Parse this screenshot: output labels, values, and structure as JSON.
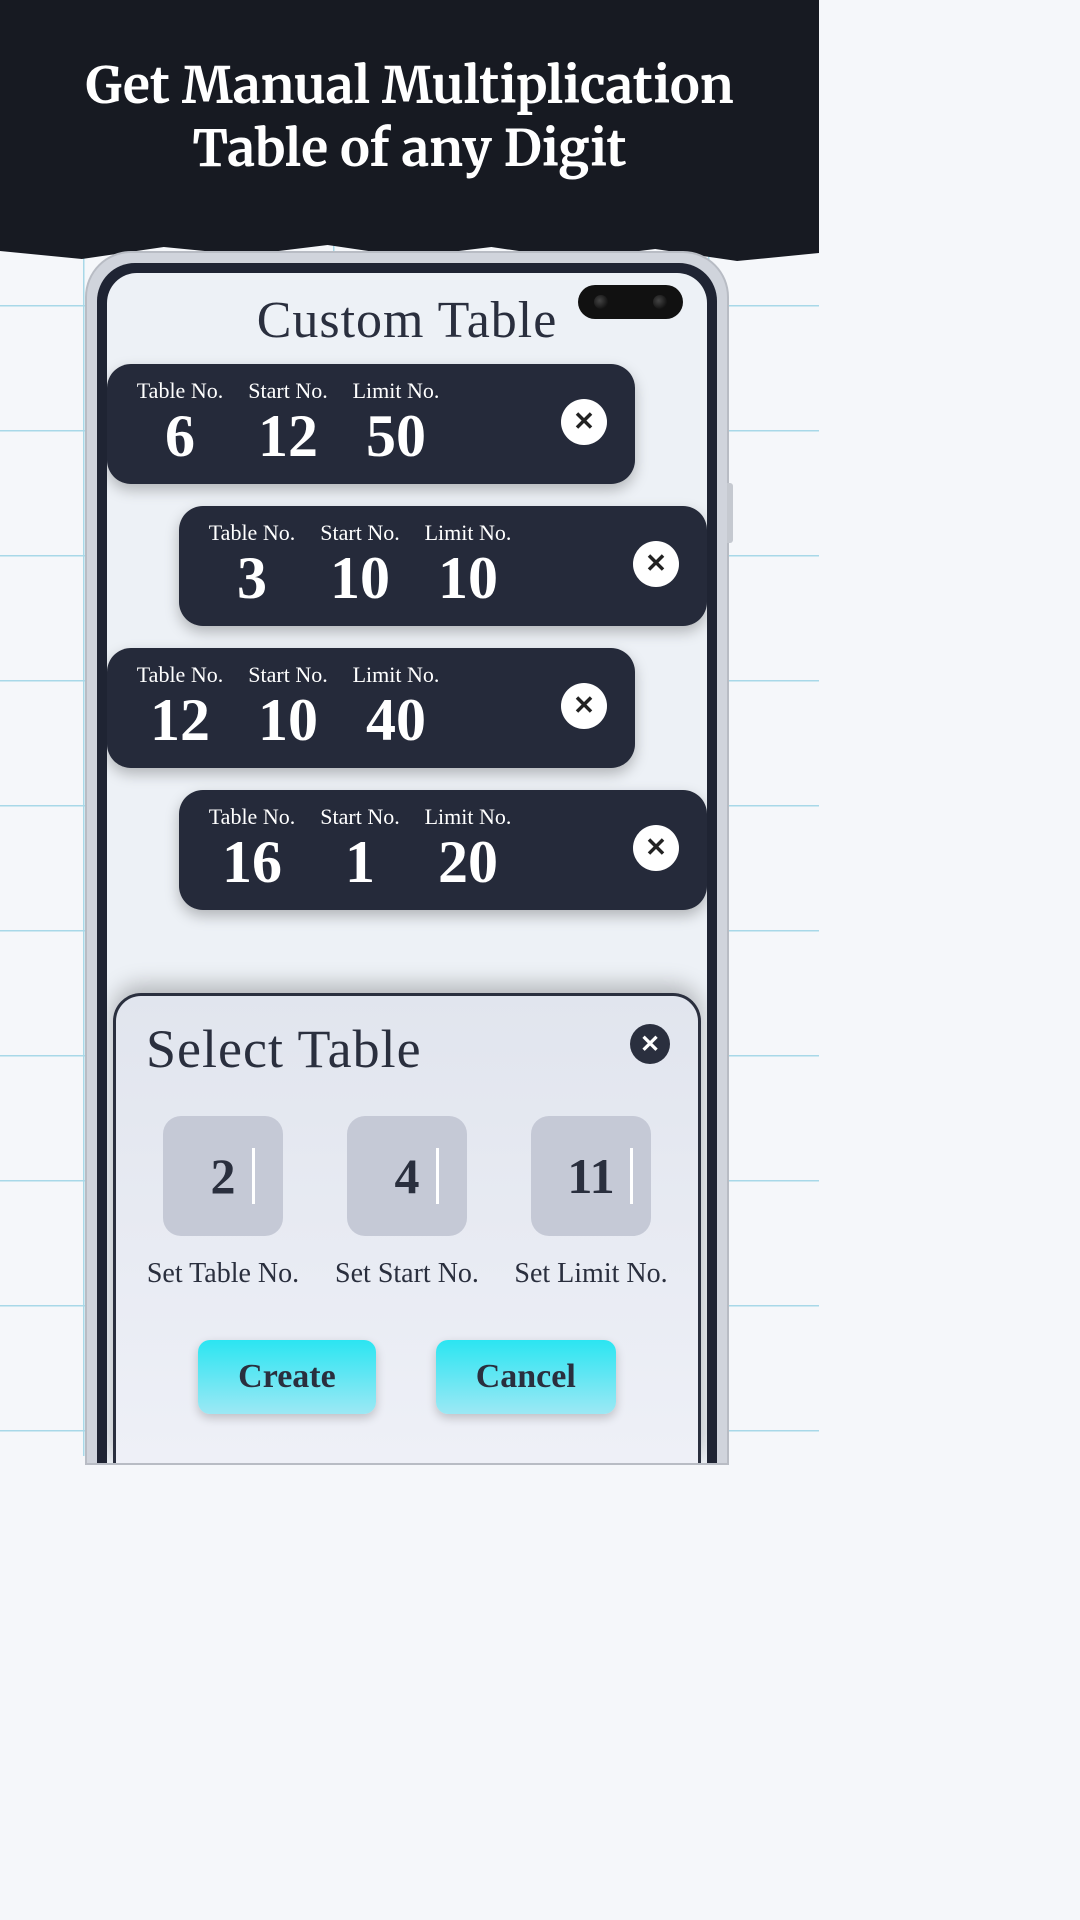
{
  "headline": "Get Manual Multiplication Table of any Digit",
  "app_title": "Custom Table",
  "labels": {
    "table": "Table No.",
    "start": "Start No.",
    "limit": "Limit No."
  },
  "cards": [
    {
      "table": "6",
      "start": "12",
      "limit": "50",
      "align": "left"
    },
    {
      "table": "3",
      "start": "10",
      "limit": "10",
      "align": "right"
    },
    {
      "table": "12",
      "start": "10",
      "limit": "40",
      "align": "left"
    },
    {
      "table": "16",
      "start": "1",
      "limit": "20",
      "align": "right"
    }
  ],
  "sheet": {
    "title": "Select Table",
    "inputs": {
      "table": {
        "value": "2",
        "label": "Set Table No."
      },
      "start": {
        "value": "4",
        "label": "Set Start No."
      },
      "limit": {
        "value": "11",
        "label": "Set Limit No."
      }
    },
    "create_label": "Create",
    "cancel_label": "Cancel"
  }
}
